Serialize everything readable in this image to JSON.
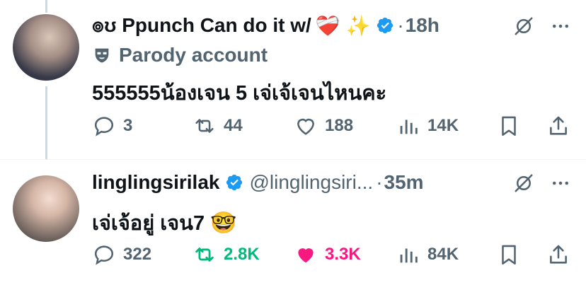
{
  "tweets": [
    {
      "author_name": "๏ʊ Ppunch Can do it w/",
      "name_emojis": "❤️‍🩹 ✨",
      "handle": "",
      "time": "18h",
      "parody_label": "Parody account",
      "text": "555555น้องเจน 5 เจ่เจ้เจนไหนคะ",
      "text_emoji": "",
      "replies": "3",
      "reposts": "44",
      "likes": "188",
      "views": "14K",
      "liked": false,
      "reposted": false
    },
    {
      "author_name": "linglingsirilak",
      "name_emojis": "",
      "handle": "@linglingsiri...",
      "time": "35m",
      "parody_label": "",
      "text": "เจ่เจ้อยู่ เจน7",
      "text_emoji": "🤓",
      "replies": "322",
      "reposts": "2.8K",
      "likes": "3.3K",
      "views": "84K",
      "liked": true,
      "reposted": true
    }
  ],
  "colors": {
    "verified": "#1d9bf0",
    "muted": "#536471",
    "repost_active": "#00ba7c",
    "like_active": "#f91880"
  },
  "icons": [
    "reply-icon",
    "repost-icon",
    "like-icon",
    "views-icon",
    "bookmark-icon",
    "share-icon",
    "grok-icon",
    "more-icon",
    "verified-badge-icon",
    "parody-mask-icon"
  ]
}
